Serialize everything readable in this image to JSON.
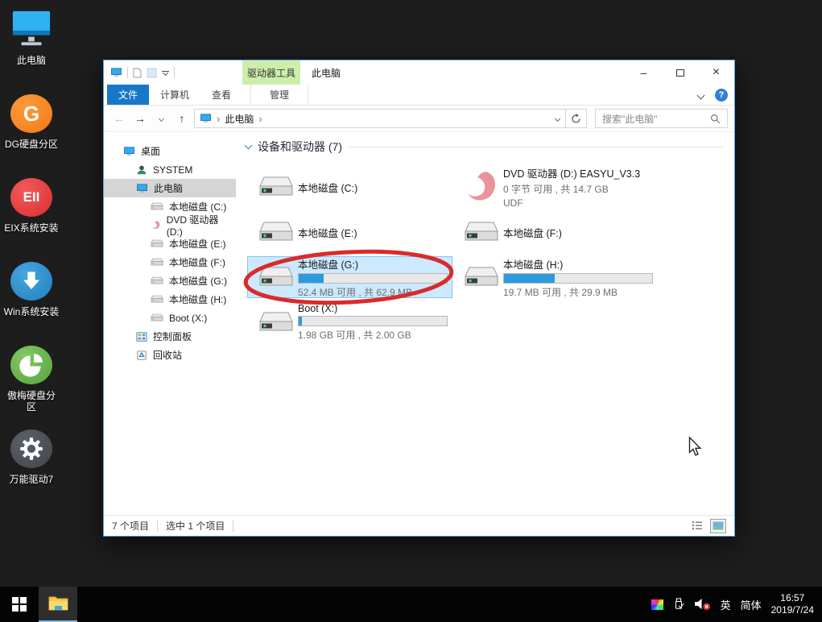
{
  "desktop": {
    "icons": [
      {
        "label": "此电脑"
      },
      {
        "label": "DG硬盘分区",
        "badge": "G"
      },
      {
        "label": "EIX系统安装",
        "badge": "EII"
      },
      {
        "label": "Win系统安装"
      },
      {
        "label": "傲梅硬盘分区"
      },
      {
        "label": "万能驱动7"
      }
    ]
  },
  "window": {
    "context_header": "驱动器工具",
    "title": "此电脑",
    "tabs": {
      "file": "文件",
      "computer": "计算机",
      "view": "查看",
      "manage": "管理"
    },
    "help_label": "?",
    "address": {
      "crumb_root": "此电脑"
    },
    "search": {
      "placeholder": "搜索\"此电脑\""
    },
    "nav": {
      "items": [
        {
          "label": "桌面"
        },
        {
          "label": "SYSTEM"
        },
        {
          "label": "此电脑"
        },
        {
          "label": "本地磁盘 (C:)"
        },
        {
          "label": "DVD 驱动器 (D:)"
        },
        {
          "label": "本地磁盘 (E:)"
        },
        {
          "label": "本地磁盘 (F:)"
        },
        {
          "label": "本地磁盘 (G:)"
        },
        {
          "label": "本地磁盘 (H:)"
        },
        {
          "label": "Boot (X:)"
        },
        {
          "label": "控制面板"
        },
        {
          "label": "回收站"
        }
      ]
    },
    "content": {
      "group_header": "设备和驱动器 (7)",
      "drives": [
        {
          "name": "本地磁盘 (C:)",
          "icon": "drive"
        },
        {
          "name": "DVD 驱动器 (D:) EASYU_V3.3",
          "size": "0 字节 可用 , 共 14.7 GB",
          "fs": "UDF",
          "icon": "dvd"
        },
        {
          "name": "本地磁盘 (E:)",
          "icon": "drive"
        },
        {
          "name": "本地磁盘 (F:)",
          "icon": "drive"
        },
        {
          "name": "本地磁盘 (G:)",
          "size": "52.4 MB 可用 , 共 62.9 MB",
          "used_pct": 17,
          "selected": true,
          "icon": "drive"
        },
        {
          "name": "本地磁盘 (H:)",
          "size": "19.7 MB 可用 , 共 29.9 MB",
          "used_pct": 34,
          "icon": "drive"
        },
        {
          "name": "Boot (X:)",
          "size": "1.98 GB 可用 , 共 2.00 GB",
          "used_pct": 2,
          "icon": "drive"
        }
      ]
    },
    "status": {
      "items": "7 个项目",
      "selected": "选中 1 个项目"
    }
  },
  "taskbar": {
    "ime_lang": "英",
    "ime_mode": "简体",
    "time": "16:57",
    "date": "2019/7/24"
  },
  "colors": {
    "accent_blue": "#2d9add",
    "selected_tile_bg": "#cce9ff",
    "context_tab_green": "#cdeeab",
    "annotation_red": "#d92b2b"
  }
}
